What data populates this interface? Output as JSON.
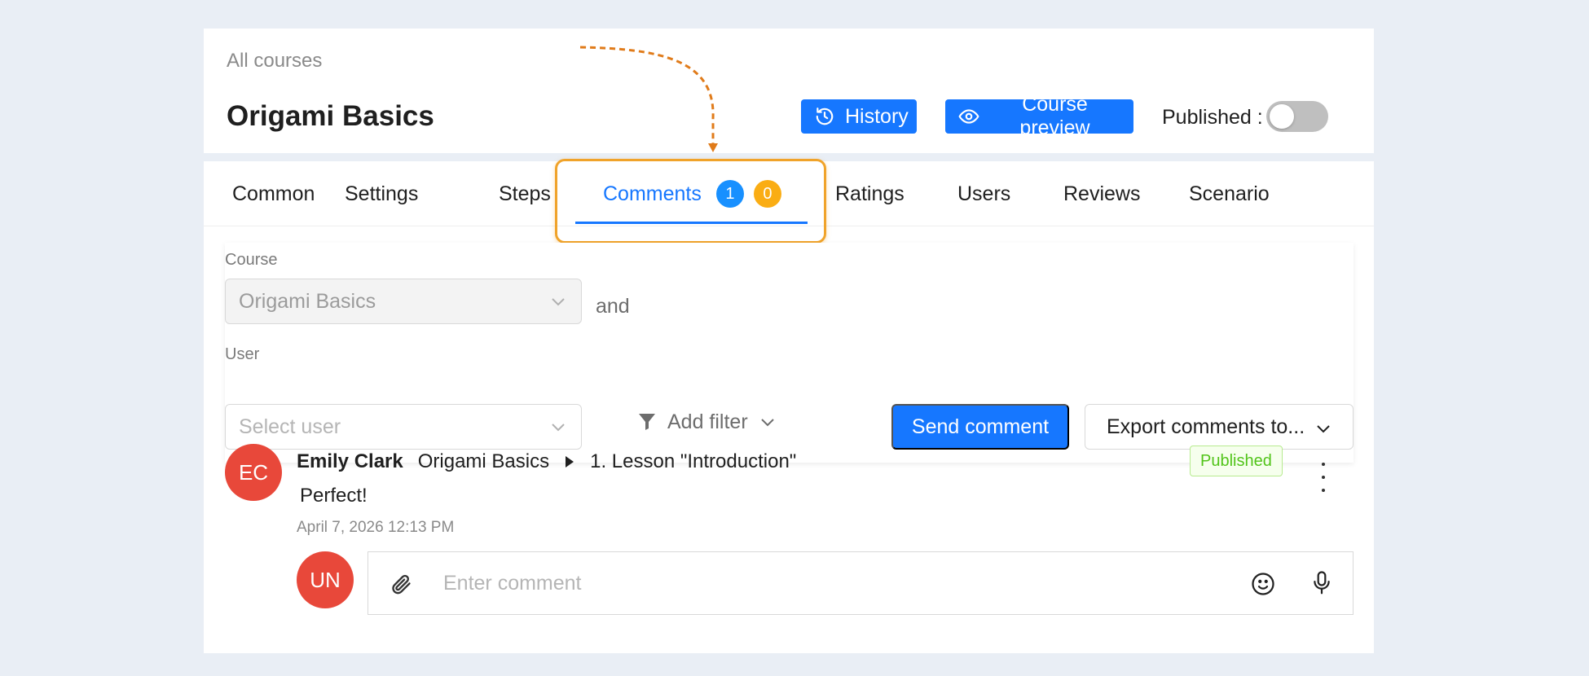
{
  "header": {
    "breadcrumb": "All courses",
    "title": "Origami Basics",
    "history_label": "History",
    "preview_label": "Course preview",
    "published_label": "Published",
    "published_on": false
  },
  "tabs": [
    {
      "label": "Common"
    },
    {
      "label": "Settings"
    },
    {
      "label": "Steps"
    },
    {
      "label": "Comments",
      "badge_blue": "1",
      "badge_orange": "0",
      "active": true
    },
    {
      "label": "Ratings"
    },
    {
      "label": "Users"
    },
    {
      "label": "Reviews"
    },
    {
      "label": "Scenario"
    }
  ],
  "filters": {
    "course_label": "Course",
    "course_value": "Origami Basics",
    "and_text": "and",
    "user_label": "User",
    "user_placeholder": "Select user",
    "add_filter_label": "Add filter",
    "send_label": "Send comment",
    "export_label": "Export comments to..."
  },
  "comment": {
    "avatar_initials": "EC",
    "author": "Emily Clark",
    "course": "Origami Basics",
    "lesson": "1. Lesson \"Introduction\"",
    "text": "Perfect!",
    "date": "April 7, 2026 12:13 PM",
    "status": "Published"
  },
  "reply": {
    "avatar_initials": "UN",
    "placeholder": "Enter comment"
  },
  "colors": {
    "primary": "#1677ff",
    "highlight": "#f0a32a",
    "avatar": "#e8483a",
    "published_tag": "#52c41a"
  }
}
